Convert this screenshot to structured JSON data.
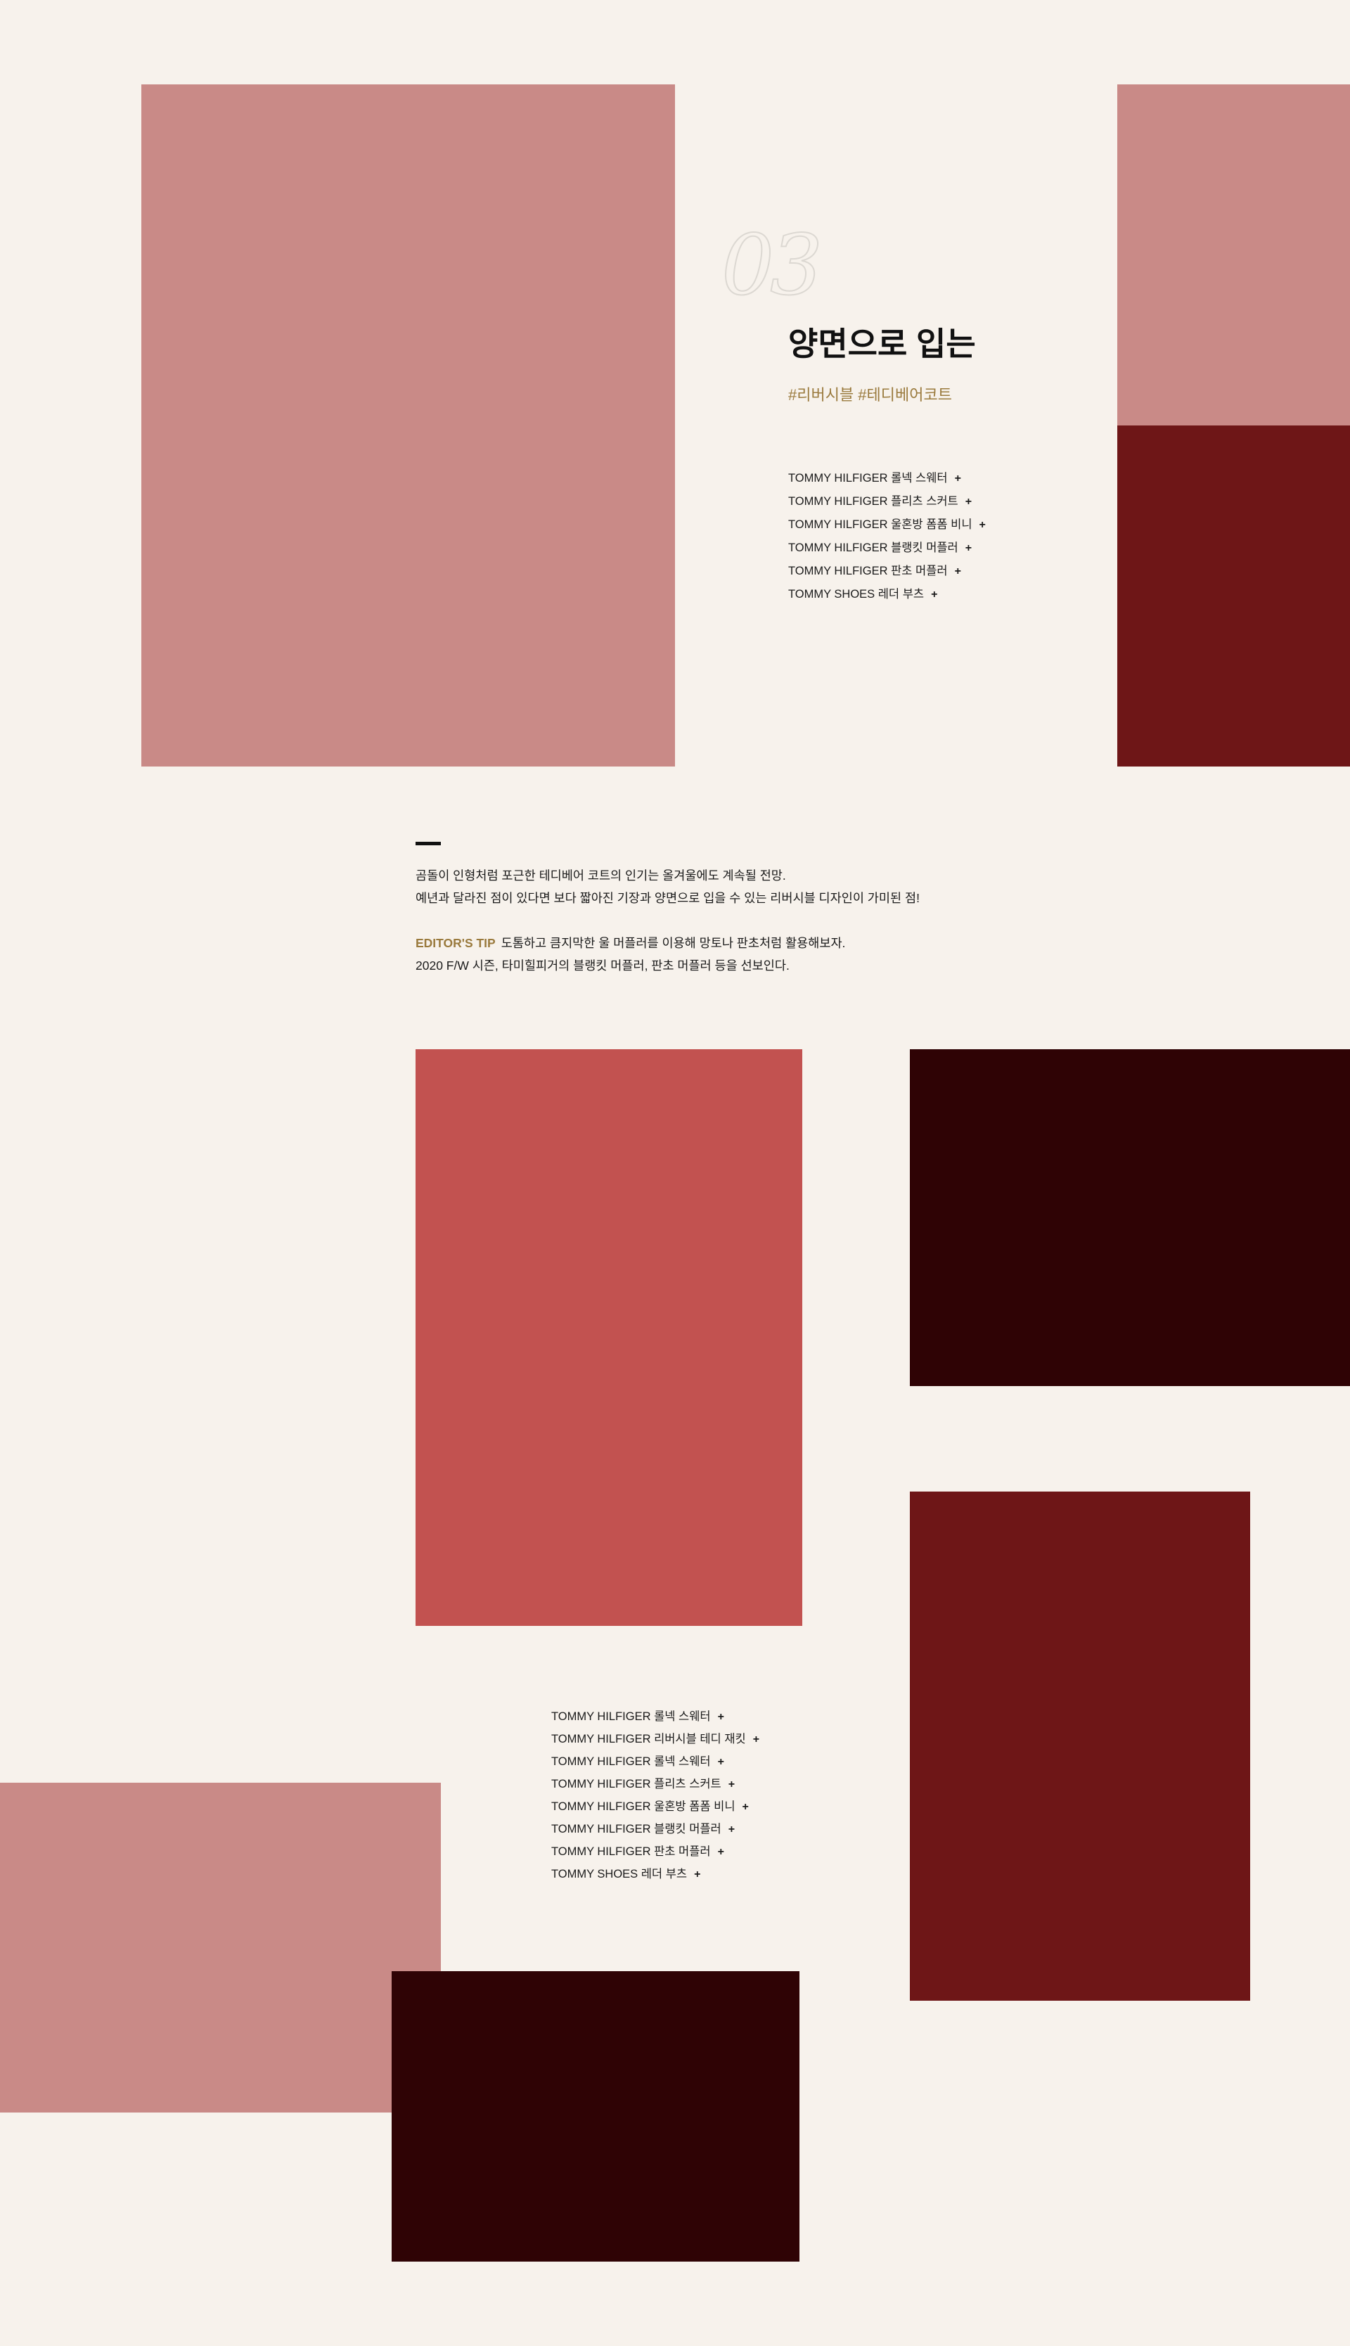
{
  "colors": {
    "background": "#f7f2ec",
    "dusty_rose": "#c98a87",
    "brick_red": "#c25250",
    "burgundy": "#6e1617",
    "dark_maroon": "#2f0305",
    "hashtag_gold": "#9a7a3d"
  },
  "section": {
    "number": "03",
    "title": "양면으로 입는",
    "hashtags": "#리버시블 #테디베어코트"
  },
  "products_top": [
    "TOMMY HILFIGER 롤넥 스웨터",
    "TOMMY HILFIGER 플리츠 스커트",
    "TOMMY HILFIGER 울혼방 폼폼 비니",
    "TOMMY HILFIGER 블랭킷 머플러",
    "TOMMY HILFIGER 판초 머플러",
    "TOMMY SHOES 레더 부츠"
  ],
  "description": {
    "line1": "곰돌이 인형처럼 포근한 테디베어 코트의 인기는 올겨울에도 계속될 전망.",
    "line2": "예년과 달라진 점이 있다면 보다 짧아진 기장과 양면으로 입을 수 있는 리버시블 디자인이 가미된 점!"
  },
  "editor_tip": {
    "label": "EDITOR'S TIP",
    "line1": "도톰하고 큼지막한 울 머플러를 이용해 망토나 판초처럼 활용해보자.",
    "line2": "2020 F/W 시즌, 타미힐피거의 블랭킷 머플러, 판초 머플러 등을 선보인다."
  },
  "products_bottom": [
    "TOMMY HILFIGER 롤넥 스웨터",
    "TOMMY HILFIGER 리버시블 테디 재킷",
    "TOMMY HILFIGER 롤넥 스웨터",
    "TOMMY HILFIGER 플리츠 스커트",
    "TOMMY HILFIGER 울혼방 폼폼 비니",
    "TOMMY HILFIGER 블랭킷 머플러",
    "TOMMY HILFIGER 판초 머플러",
    "TOMMY SHOES 레더 부츠"
  ],
  "plus_icon": "+"
}
